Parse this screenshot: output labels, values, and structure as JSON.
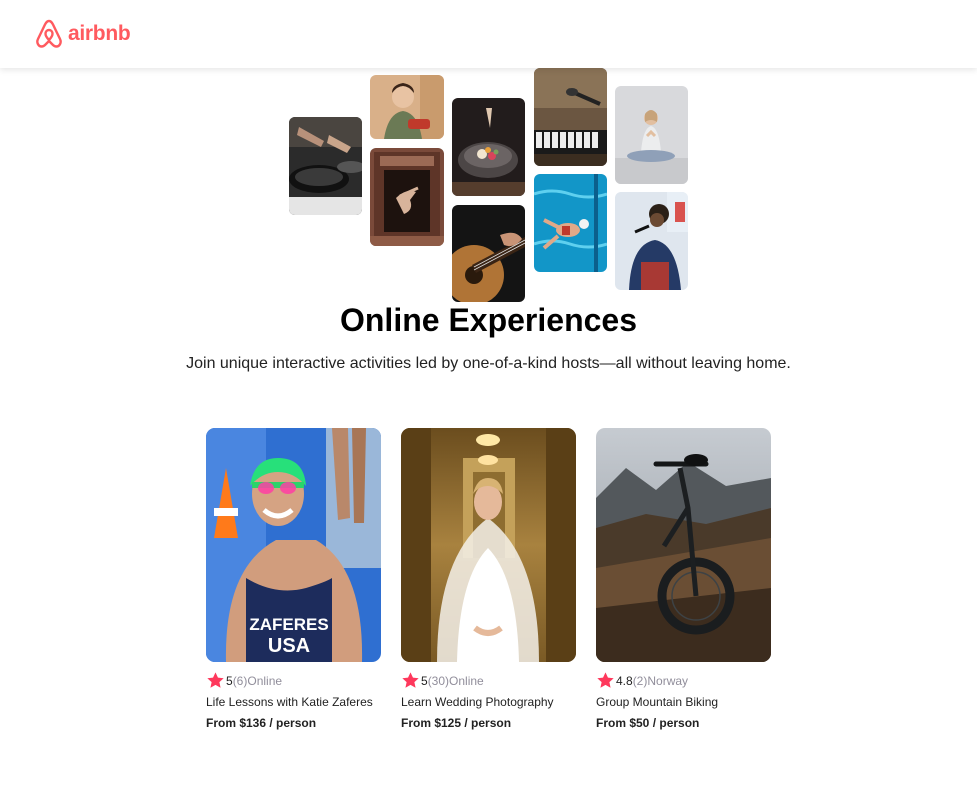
{
  "header": {
    "logo_text": "airbnb",
    "brand_color": "#FF5A5F"
  },
  "hero": {
    "title": "Online Experiences",
    "subtitle": "Join unique interactive activities led by one-of-a-kind hosts—all without leaving home.",
    "photos": [
      "cooking",
      "woman-with-food",
      "dancer-in-doorway",
      "plated-dish",
      "guitar",
      "microphone-keyboard",
      "swimmer",
      "meditation",
      "singer"
    ]
  },
  "cards": [
    {
      "rating": "5",
      "review_count": "(6)",
      "location": "Online",
      "title": "Life Lessons with Katie Zaferes",
      "price": "From $136",
      "per": " / person"
    },
    {
      "rating": "5",
      "review_count": "(30)",
      "location": "Online",
      "title": "Learn Wedding Photography",
      "price": "From $125",
      "per": " / person"
    },
    {
      "rating": "4.8",
      "review_count": "(2)",
      "location": "Norway",
      "title": "Group Mountain Biking",
      "price": "From $50",
      "per": " / person"
    }
  ],
  "colors": {
    "star": "#FE385C",
    "muted_text": "#918E9B"
  }
}
